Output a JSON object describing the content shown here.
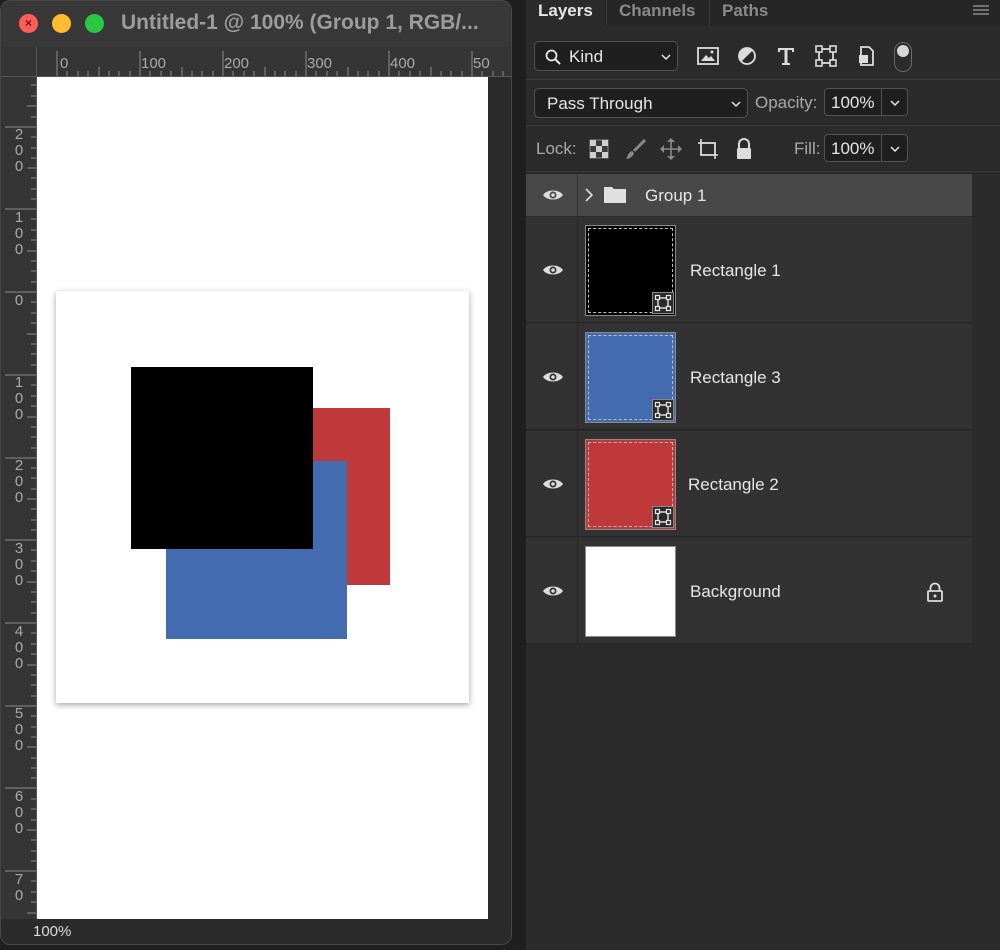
{
  "document_window": {
    "title": "Untitled-1 @ 100% (Group 1, RGB/...",
    "ruler_top_labels": [
      "0",
      "100",
      "200",
      "300",
      "400",
      "50"
    ],
    "ruler_left_labels": [
      [
        "2",
        "0",
        "0"
      ],
      [
        "1",
        "0",
        "0"
      ],
      [
        "0"
      ],
      [
        "1",
        "0",
        "0"
      ],
      [
        "2",
        "0",
        "0"
      ],
      [
        "3",
        "0",
        "0"
      ],
      [
        "4",
        "0",
        "0"
      ],
      [
        "5",
        "0",
        "0"
      ],
      [
        "6",
        "0",
        "0"
      ],
      [
        "7",
        "0"
      ]
    ],
    "zoom": "100%",
    "shape_colors": {
      "black": "#000000",
      "blue": "#426bb0",
      "red": "#bf383a"
    }
  },
  "layers_panel": {
    "tabs": [
      "Layers",
      "Channels",
      "Paths"
    ],
    "filter_kind": "Kind",
    "blend_mode": "Pass Through",
    "opacity_label": "Opacity:",
    "opacity_value": "100%",
    "lock_label": "Lock:",
    "fill_label": "Fill:",
    "fill_value": "100%",
    "group": {
      "name": "Group 1"
    },
    "layers": [
      {
        "name": "Rectangle 1",
        "thumb_color": "#000000",
        "locked": false
      },
      {
        "name": "Rectangle 3",
        "thumb_color": "#426bb0",
        "locked": false
      },
      {
        "name": "Rectangle 2",
        "thumb_color": "#bf383a",
        "locked": false
      },
      {
        "name": "Background",
        "thumb_color": "#ffffff",
        "locked": true
      }
    ]
  }
}
